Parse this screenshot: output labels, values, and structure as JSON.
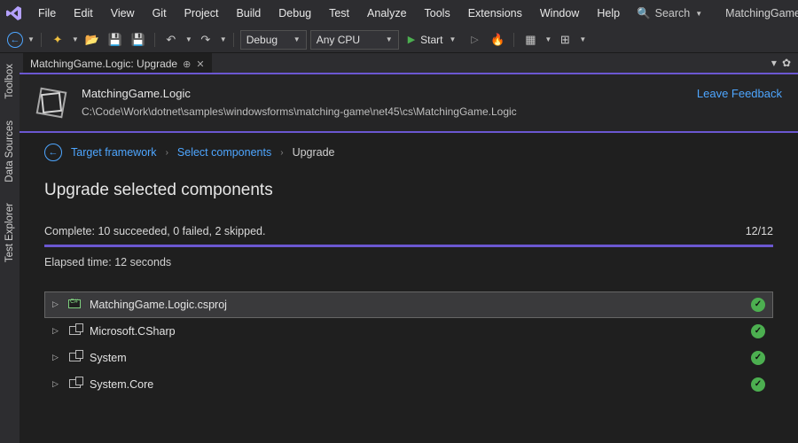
{
  "menu": [
    "File",
    "Edit",
    "View",
    "Git",
    "Project",
    "Build",
    "Debug",
    "Test",
    "Analyze",
    "Tools",
    "Extensions",
    "Window",
    "Help"
  ],
  "search_label": "Search",
  "solution_name": "MatchingGame",
  "toolbar": {
    "config": "Debug",
    "platform": "Any CPU",
    "start": "Start"
  },
  "sidetabs": [
    "Toolbox",
    "Data Sources",
    "Test Explorer"
  ],
  "tab": {
    "label": "MatchingGame.Logic: Upgrade"
  },
  "header": {
    "title": "MatchingGame.Logic",
    "path": "C:\\Code\\Work\\dotnet\\samples\\windowsforms\\matching-game\\net45\\cs\\MatchingGame.Logic",
    "feedback": "Leave Feedback"
  },
  "breadcrumbs": {
    "a": "Target framework",
    "b": "Select components",
    "c": "Upgrade"
  },
  "page_title": "Upgrade selected components",
  "status": {
    "complete": "Complete: 10 succeeded, 0 failed, 2 skipped.",
    "count": "12/12"
  },
  "elapsed": "Elapsed time: 12 seconds",
  "results": [
    {
      "name": "MatchingGame.Logic.csproj",
      "kind": "proj"
    },
    {
      "name": "Microsoft.CSharp",
      "kind": "ref"
    },
    {
      "name": "System",
      "kind": "ref"
    },
    {
      "name": "System.Core",
      "kind": "ref"
    }
  ]
}
